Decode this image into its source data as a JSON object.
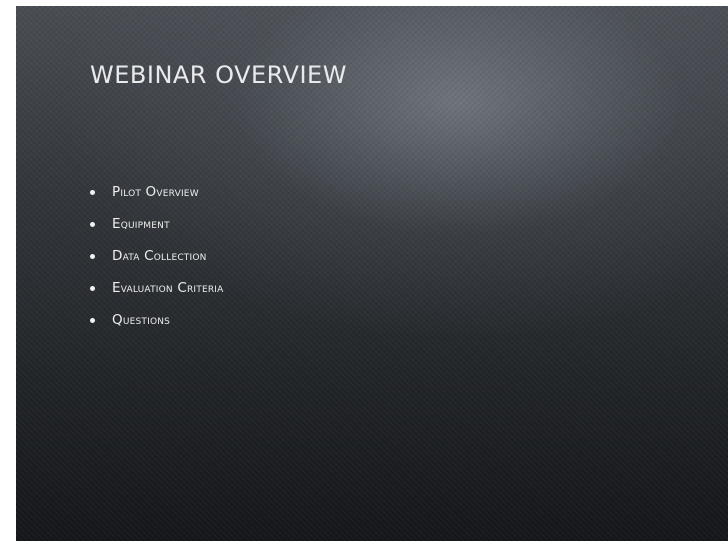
{
  "slide": {
    "title": "WEBINAR OVERVIEW",
    "bullets": [
      "Pilot Overview",
      "Equipment",
      "Data Collection",
      "Evaluation Criteria",
      "Questions"
    ]
  },
  "colors": {
    "background_dark": "#15171a",
    "background_light": "#4a4e54",
    "text": "#eeeeee"
  }
}
